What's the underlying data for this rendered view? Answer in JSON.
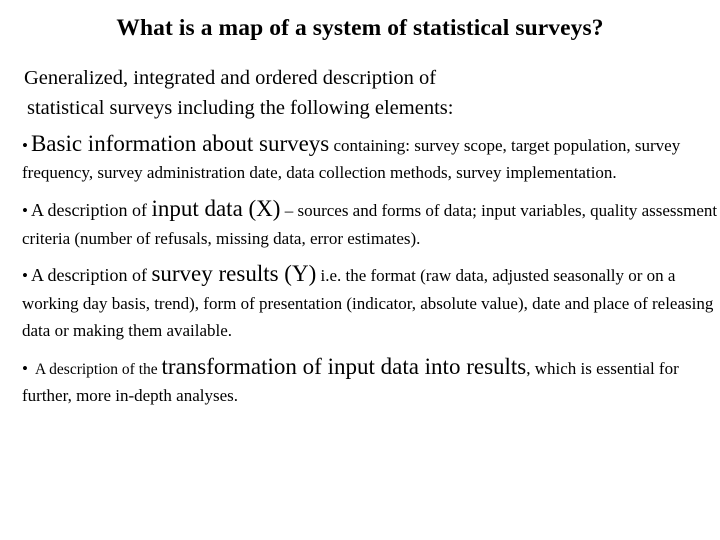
{
  "slide": {
    "title": "What is a map of a system of statistical surveys?",
    "intro": {
      "line1": "Generalized, integrated and ordered description of",
      "line2": "statistical surveys including the following elements:"
    },
    "bullet_marker": "•",
    "bullets": [
      {
        "id": "basic-information",
        "lead": "",
        "emphasis": "Basic information about surveys",
        "rest": " containing: survey scope, target population, survey frequency, survey administration date, data collection methods, survey implementation."
      },
      {
        "id": "input-data",
        "lead": "A description of ",
        "emphasis": "input data (X)",
        "rest": " – sources and forms of data; input variables, quality assessment criteria (number of refusals, missing data, error estimates)."
      },
      {
        "id": "survey-results",
        "lead": "A description of ",
        "emphasis": "survey results (Y)",
        "rest": " i.e. the format (raw data, adjusted seasonally or on a working day basis, trend), form of presentation (indicator, absolute value), date and place of releasing data or making them available."
      },
      {
        "id": "transformation",
        "lead": "A description of the ",
        "emphasis": "transformation of input data into results",
        "rest": ", which is essential for further, more in-depth analyses."
      }
    ]
  }
}
